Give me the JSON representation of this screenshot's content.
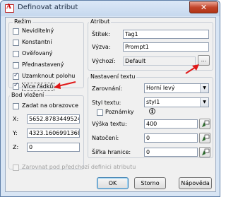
{
  "window": {
    "title": "Definovat atribut",
    "close_label": "✕"
  },
  "rezim": {
    "legend": "Režim",
    "items": [
      {
        "label": "Neviditelný",
        "checked": false
      },
      {
        "label": "Konstantní",
        "checked": false
      },
      {
        "label": "Ověřovaný",
        "checked": false
      },
      {
        "label": "Přednastavený",
        "checked": false
      },
      {
        "label": "Uzamknout polohu",
        "checked": true
      },
      {
        "label": "Více řádků",
        "checked": true
      }
    ]
  },
  "bod_vlozeni": {
    "legend": "Bod vložení",
    "zadat_label": "Zadat na obrazovce",
    "x_label": "X:",
    "x_value": "5652.878344952449",
    "y_label": "Y:",
    "y_value": "4323.160699136835",
    "z_label": "Z:",
    "z_value": "0"
  },
  "atribut": {
    "legend": "Atribut",
    "stitek_label": "Štítek:",
    "stitek_value": "Tag1",
    "vyzva_label": "Výzva:",
    "vyzva_value": "Prompt1",
    "vychozi_label": "Výchozí:",
    "vychozi_value": "Default",
    "browse_label": "..."
  },
  "nastaveni": {
    "legend": "Nastavení textu",
    "zarovnani_label": "Zarovnání:",
    "zarovnani_value": "Horní levý",
    "styl_label": "Styl textu:",
    "styl_value": "styl1",
    "poznamky_label": "Poznámky",
    "vyska_label": "Výška textu:",
    "vyska_value": "400",
    "natoceni_label": "Natočení:",
    "natoceni_value": "0",
    "sirka_label": "Šířka hranice:",
    "sirka_value": "0"
  },
  "zarovnat_label": "Zarovnat pod předchozí definici atributu",
  "buttons": {
    "ok": "OK",
    "storno": "Storno",
    "napoveda": "Nápověda"
  },
  "colors": {
    "annotation_arrow": "#e01818"
  }
}
